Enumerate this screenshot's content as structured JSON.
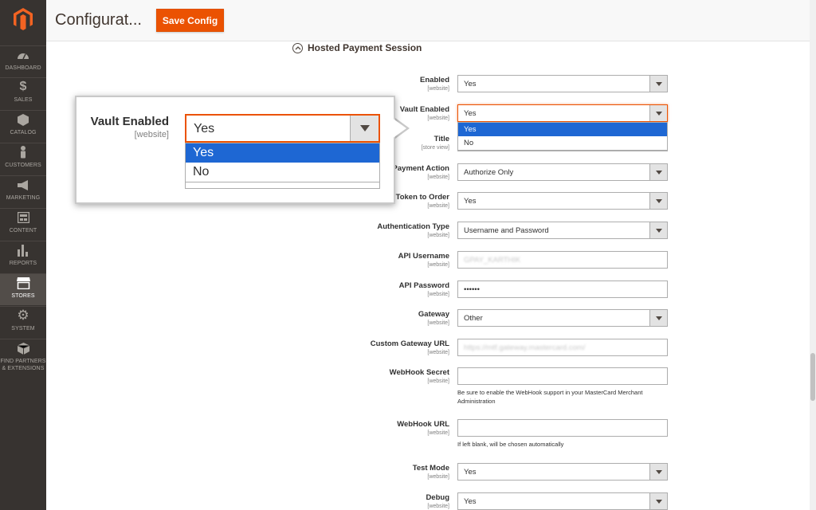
{
  "nav": [
    {
      "label": "DASHBOARD",
      "icon": "dashboard-icon"
    },
    {
      "label": "SALES",
      "icon": "dollar-icon"
    },
    {
      "label": "CATALOG",
      "icon": "cube-icon"
    },
    {
      "label": "CUSTOMERS",
      "icon": "person-icon"
    },
    {
      "label": "MARKETING",
      "icon": "megaphone-icon"
    },
    {
      "label": "CONTENT",
      "icon": "layout-icon"
    },
    {
      "label": "REPORTS",
      "icon": "bar-chart-icon"
    },
    {
      "label": "STORES",
      "icon": "storefront-icon"
    },
    {
      "label": "SYSTEM",
      "icon": "gear-icon"
    },
    {
      "label": "FIND PARTNERS & EXTENSIONS",
      "icon": "box-icon"
    }
  ],
  "header": {
    "title": "Configurat...",
    "save_label": "Save Config"
  },
  "section": {
    "title": "Hosted Payment Session"
  },
  "fields": {
    "enabled": {
      "label": "Enabled",
      "scope": "[website]",
      "value": "Yes"
    },
    "vault_enabled": {
      "label": "Vault Enabled",
      "scope": "[website]",
      "value": "Yes",
      "options": [
        "Yes",
        "No"
      ]
    },
    "title": {
      "label": "Title",
      "scope": "[store view]"
    },
    "payment_action": {
      "label": "Payment Action",
      "scope": "[website]",
      "value": "Authorize Only"
    },
    "token_to_order": {
      "label": "Token to Order",
      "scope": "[website]",
      "value": "Yes"
    },
    "auth_type": {
      "label": "Authentication Type",
      "scope": "[website]",
      "value": "Username and Password"
    },
    "api_username": {
      "label": "API Username",
      "scope": "[website]",
      "value": "GPAY_KARTHIK"
    },
    "api_password": {
      "label": "API Password",
      "scope": "[website]",
      "value": "••••••"
    },
    "gateway": {
      "label": "Gateway",
      "scope": "[website]",
      "value": "Other"
    },
    "custom_gateway_url": {
      "label": "Custom Gateway URL",
      "scope": "[website]",
      "value": "https://mtf.gateway.mastercard.com/"
    },
    "webhook_secret": {
      "label": "WebHook Secret",
      "scope": "[website]",
      "value": "",
      "note": "Be sure to enable the WebHook support in your MasterCard Merchant Administration"
    },
    "webhook_url": {
      "label": "WebHook URL",
      "scope": "[website]",
      "value": "",
      "note": "If left blank, will be chosen automatically"
    },
    "test_mode": {
      "label": "Test Mode",
      "scope": "[website]",
      "value": "Yes"
    },
    "debug": {
      "label": "Debug",
      "scope": "[website]",
      "value": "Yes"
    }
  },
  "callout": {
    "label": "Vault Enabled",
    "scope": "[website]",
    "value": "Yes",
    "options": [
      "Yes",
      "No"
    ]
  },
  "colors": {
    "accent": "#eb5202",
    "sidebar": "#373330",
    "selection": "#1e67d3"
  }
}
